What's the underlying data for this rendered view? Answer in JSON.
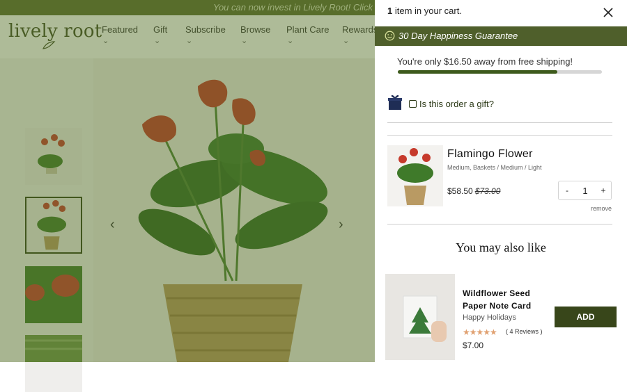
{
  "announcement": "You can now invest in Lively Root! Click to l",
  "store": {
    "logo": "lively root",
    "nav": [
      "Featured",
      "Gift",
      "Subscribe",
      "Browse",
      "Plant Care",
      "Rewards"
    ]
  },
  "cart": {
    "count": "1",
    "count_suffix": "item in your cart.",
    "guarantee": "30 Day Happiness Guarantee",
    "shipping_msg": "You're only $16.50 away from free shipping!",
    "shipping_progress": 0.78,
    "gift_label": "Is this order a gift?",
    "item": {
      "title": "Flamingo Flower",
      "variant": "Medium, Baskets / Medium / Light",
      "price": "$58.50",
      "compare_price": "$73.00",
      "qty_minus": "-",
      "quantity": "1",
      "qty_plus": "+",
      "remove": "remove"
    },
    "upsell_heading": "You may also like",
    "recommendation": {
      "title": "Wildflower Seed Paper Note Card",
      "variant": "Happy Holidays",
      "stars": "★★★★★",
      "reviews": "( 4 Reviews )",
      "price": "$7.00",
      "add_label": "ADD"
    }
  },
  "colors": {
    "brand_green": "#4f5f2b",
    "button_green": "#38461a",
    "overlay": "#567028"
  }
}
